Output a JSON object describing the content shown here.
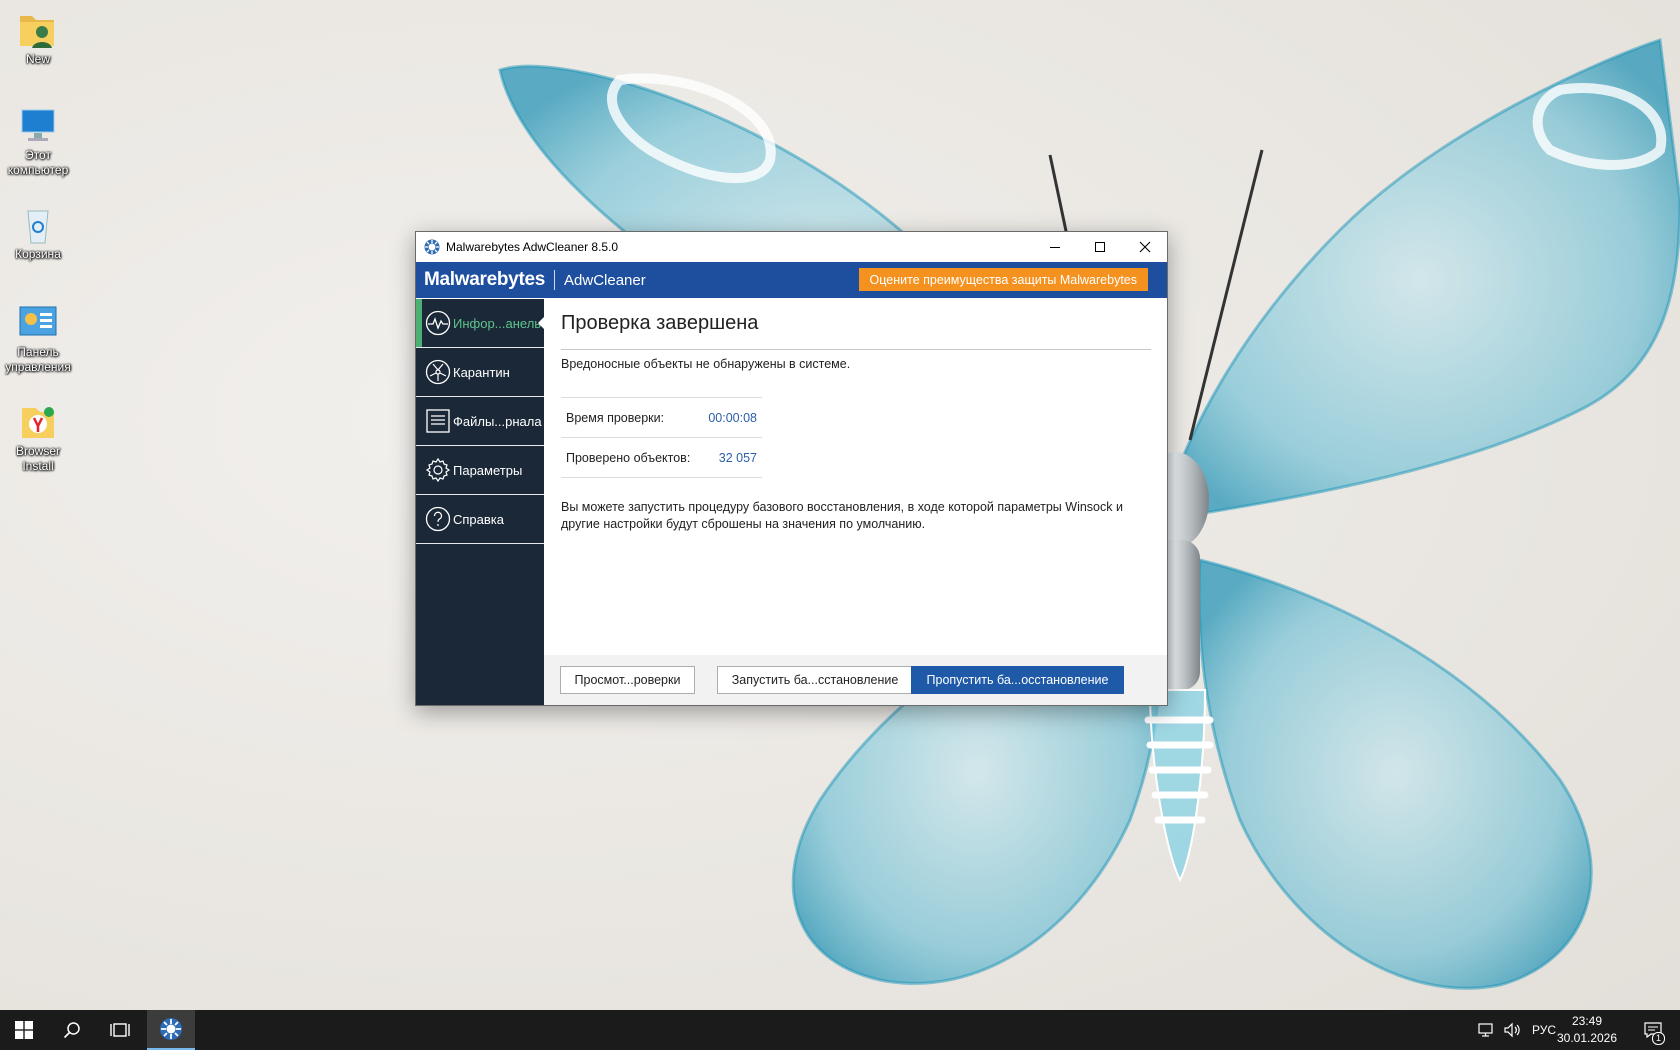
{
  "desktop": {
    "icons": [
      {
        "label": "New"
      },
      {
        "label": "Этот компьютер"
      },
      {
        "label": "Корзина"
      },
      {
        "label": "Панель управления"
      },
      {
        "label": "Browser Install"
      }
    ]
  },
  "window": {
    "title": "Malwarebytes AdwCleaner 8.5.0",
    "brand": "Malwarebytes",
    "product": "AdwCleaner",
    "promo_label": "Оцените преимущества защиты Malwarebytes",
    "nav": [
      {
        "label": "Инфор...анель",
        "icon": "dashboard-pulse-icon",
        "active": true
      },
      {
        "label": "Карантин",
        "icon": "quarantine-icon"
      },
      {
        "label": "Файлы...рнала",
        "icon": "log-file-icon"
      },
      {
        "label": "Параметры",
        "icon": "gear-icon"
      },
      {
        "label": "Справка",
        "icon": "help-icon"
      }
    ],
    "heading": "Проверка завершена",
    "status": "Вредоносные объекты не обнаружены в системе.",
    "stats": [
      {
        "label": "Время проверки:",
        "value": "00:00:08"
      },
      {
        "label": "Проверено объектов:",
        "value": "32 057"
      }
    ],
    "info": "Вы можете запустить процедуру базового восстановления, в ходе которой параметры Winsock и другие настройки будут сброшены на значения по умолчанию.",
    "buttons": {
      "view_log": "Просмот...роверки",
      "run_repair": "Запустить ба...сстановление",
      "skip_repair": "Пропустить ба...осстановление"
    }
  },
  "taskbar": {
    "language": "РУС",
    "time": "23:49",
    "date": "30.01.2026",
    "notification_count": "1"
  },
  "colors": {
    "brand_blue": "#1e4f9e",
    "promo_orange": "#f5911e",
    "sidebar_dark": "#1b2838",
    "active_green": "#5fc38a",
    "primary_button": "#1e5aa8"
  }
}
